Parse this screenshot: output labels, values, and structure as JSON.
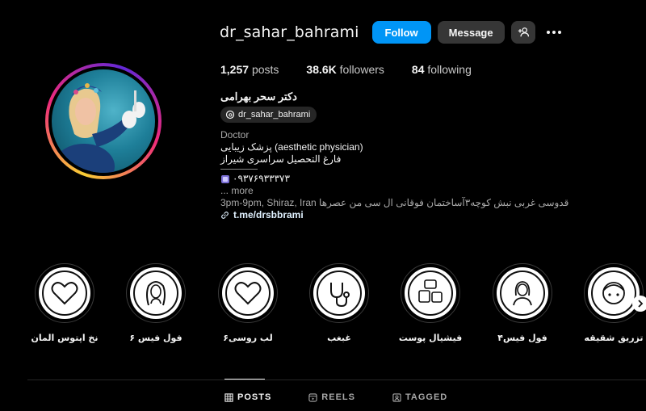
{
  "profile": {
    "username": "dr_sahar_bahrami",
    "follow_label": "Follow",
    "message_label": "Message",
    "avatar_icon": "profile-photo",
    "stats": {
      "posts_count": "1,257",
      "posts_label": "posts",
      "followers_count": "38.6K",
      "followers_label": "followers",
      "following_count": "84",
      "following_label": "following"
    },
    "bio": {
      "name": "دکتر سحر بهرامی",
      "threads_handle": "dr_sahar_bahrami",
      "category": "Doctor",
      "line1": "پزشک زیبایی (aesthetic physician)",
      "line2": "فارغ التحصیل سراسری شیراز",
      "phone": "۰۹۳۷۶۹۳۳۳۷۳",
      "more": "... more",
      "address": "3pm-9pm, Shiraz, Iran قدوسی غربی نبش کوچه۳آساختمان فوقانی ال سی من عصرها",
      "link": "t.me/drsbbrami"
    }
  },
  "highlights": [
    {
      "label": "نخ اپتوس المان",
      "icon": "heart-icon"
    },
    {
      "label": "فول فیس ۶",
      "icon": "woman-hair-icon"
    },
    {
      "label": "لب روسی۶",
      "icon": "heart-icon"
    },
    {
      "label": "غبغب",
      "icon": "stethoscope-icon"
    },
    {
      "label": "فیشیال پوست",
      "icon": "cream-jars-icon"
    },
    {
      "label": "فول فیس۴",
      "icon": "woman-portrait-icon"
    },
    {
      "label": "تزریق شقیقه",
      "icon": "face-icon"
    }
  ],
  "tabs": [
    {
      "label": "POSTS",
      "icon": "grid-icon",
      "active": true
    },
    {
      "label": "REELS",
      "icon": "reels-icon",
      "active": false
    },
    {
      "label": "TAGGED",
      "icon": "tagged-icon",
      "active": false
    }
  ],
  "colors": {
    "background": "#000000",
    "follow_button": "#0095f6",
    "secondary_button": "#363636"
  }
}
